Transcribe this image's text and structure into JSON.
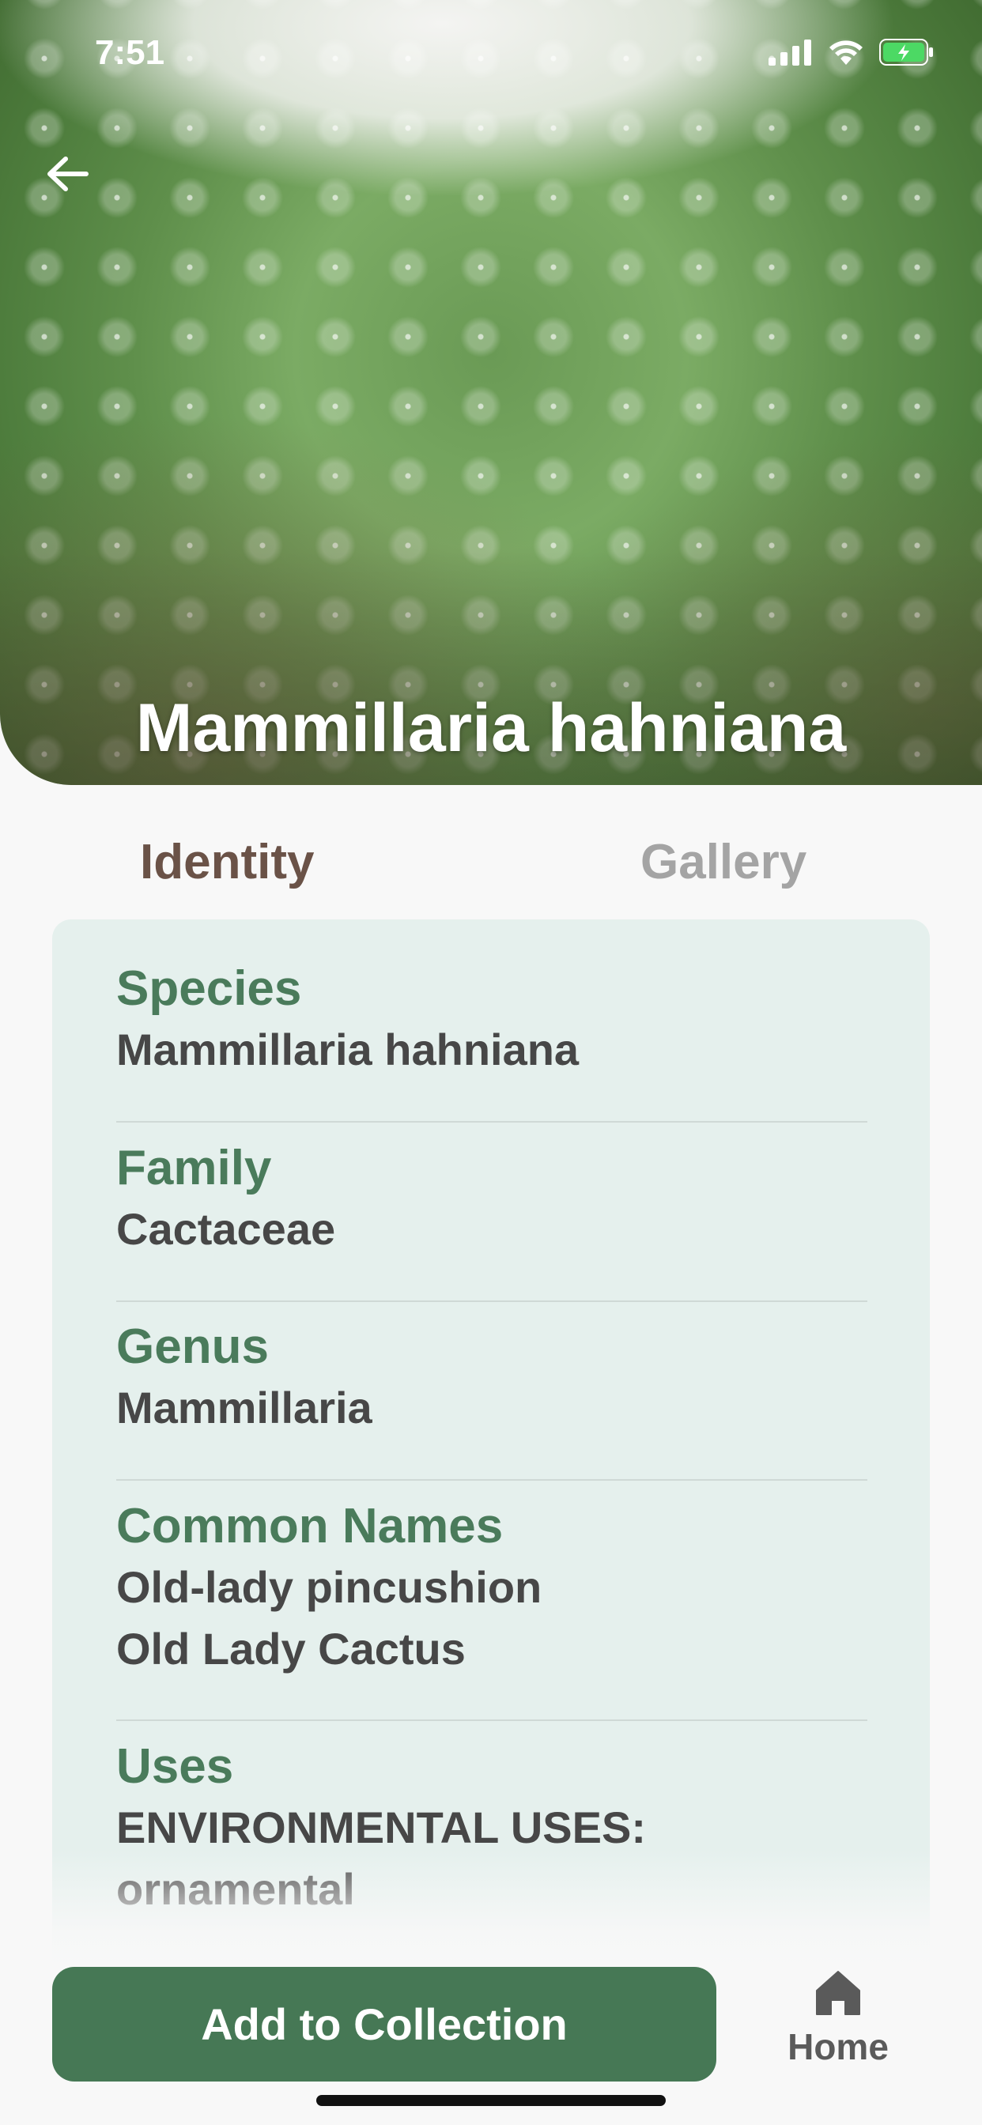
{
  "status_bar": {
    "time": "7:51"
  },
  "hero": {
    "title": "Mammillaria hahniana"
  },
  "tabs": [
    {
      "label": "Identity",
      "active": true
    },
    {
      "label": "Gallery",
      "active": false
    }
  ],
  "identity": {
    "species": {
      "label": "Species",
      "value": "Mammillaria hahniana"
    },
    "family": {
      "label": "Family",
      "value": "Cactaceae"
    },
    "genus": {
      "label": "Genus",
      "value": "Mammillaria"
    },
    "common_names": {
      "label": "Common Names",
      "values": [
        "Old-lady pincushion",
        "Old Lady Cactus"
      ]
    },
    "uses": {
      "label": "Uses",
      "values": [
        "ENVIRONMENTAL USES:",
        "ornamental"
      ]
    }
  },
  "actions": {
    "add_label": "Add to Collection"
  },
  "nav": {
    "home_label": "Home"
  },
  "colors": {
    "accent": "#467855",
    "label_green": "#4a7b5b",
    "active_tab": "#6a5247",
    "inactive_tab": "#a4a4a4",
    "card_bg": "#e5f0ed"
  },
  "icons": [
    "back-arrow-icon",
    "signal-icon",
    "wifi-icon",
    "battery-charging-icon",
    "home-icon"
  ]
}
